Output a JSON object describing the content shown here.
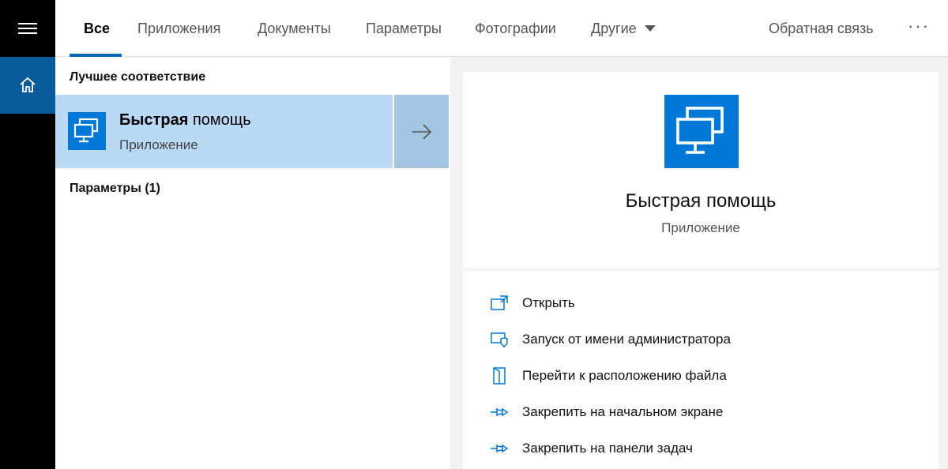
{
  "rail": {
    "menu_icon": "hamburger-icon",
    "home_icon": "home-icon"
  },
  "tabs": [
    {
      "label": "Все",
      "active": true
    },
    {
      "label": "Приложения"
    },
    {
      "label": "Документы"
    },
    {
      "label": "Параметры"
    },
    {
      "label": "Фотографии"
    }
  ],
  "more_tab": {
    "label": "Другие",
    "icon": "chevron-down-icon"
  },
  "feedback": {
    "label": "Обратная связь"
  },
  "overflow": {
    "label": "···"
  },
  "results": {
    "best_match_header": "Лучшее соответствие",
    "best_match": {
      "title_bold": "Быстрая",
      "title_rest": " помощь",
      "subtitle": "Приложение",
      "icon": "remote-assist-icon",
      "arrow_icon": "arrow-right-icon"
    },
    "settings_header": "Параметры (1)"
  },
  "detail": {
    "title": "Быстрая помощь",
    "subtitle": "Приложение",
    "actions": [
      {
        "label": "Открыть",
        "icon": "open-icon"
      },
      {
        "label": "Запуск от имени администратора",
        "icon": "admin-shield-icon"
      },
      {
        "label": "Перейти к расположению файла",
        "icon": "file-location-icon"
      },
      {
        "label": "Закрепить на начальном экране",
        "icon": "pin-icon"
      },
      {
        "label": "Закрепить на панели задач",
        "icon": "pin-icon"
      }
    ]
  },
  "colors": {
    "accent": "#0078d7",
    "selection": "#b9d9f5",
    "rail_bg": "#000000",
    "home_active": "#0a5b9a"
  }
}
